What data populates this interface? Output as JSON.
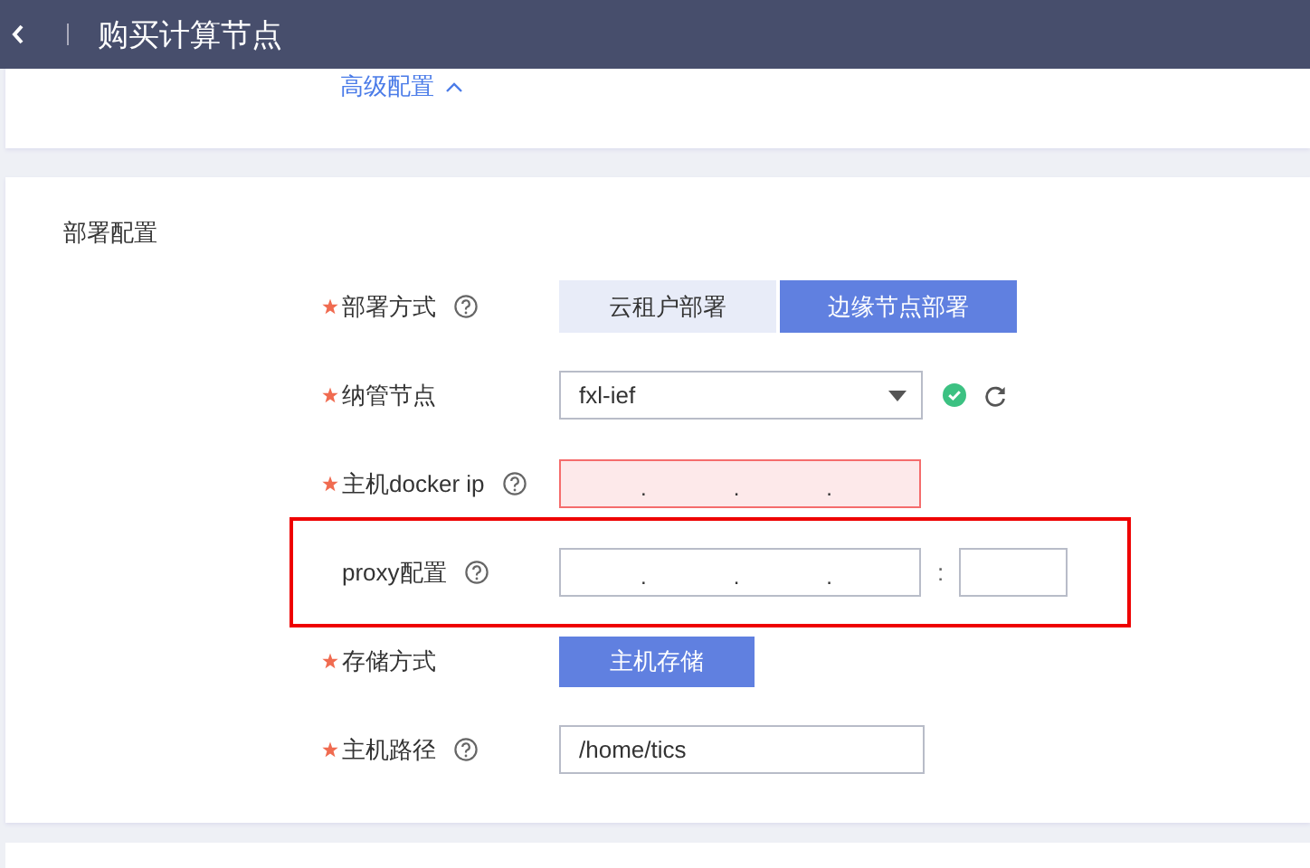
{
  "header": {
    "title": "购买计算节点"
  },
  "advanced_link": {
    "label": "高级配置"
  },
  "section": {
    "title": "部署配置",
    "rows": [
      {
        "kind": "segmented",
        "label": "部署方式",
        "required": true,
        "help": true,
        "highlighted": false,
        "options": [
          {
            "label": "云租户部署",
            "selected": false
          },
          {
            "label": "边缘节点部署",
            "selected": true
          }
        ]
      },
      {
        "kind": "select",
        "label": "纳管节点",
        "required": true,
        "help": false,
        "highlighted": false,
        "value": "fxl-ief",
        "status_ok": true,
        "refresh": true
      },
      {
        "kind": "ip",
        "label": "主机docker ip",
        "required": true,
        "help": true,
        "highlighted": false,
        "invalid": true,
        "separators": [
          ".",
          ".",
          "."
        ]
      },
      {
        "kind": "ip-port",
        "label": "proxy配置",
        "required": false,
        "help": true,
        "highlighted": true,
        "invalid": false,
        "separators": [
          ".",
          ".",
          "."
        ],
        "port_separator": ":"
      },
      {
        "kind": "button",
        "label": "存储方式",
        "required": true,
        "help": false,
        "highlighted": false,
        "button": "主机存储"
      },
      {
        "kind": "text",
        "label": "主机路径",
        "required": true,
        "help": true,
        "highlighted": false,
        "value": "/home/tics"
      }
    ]
  }
}
